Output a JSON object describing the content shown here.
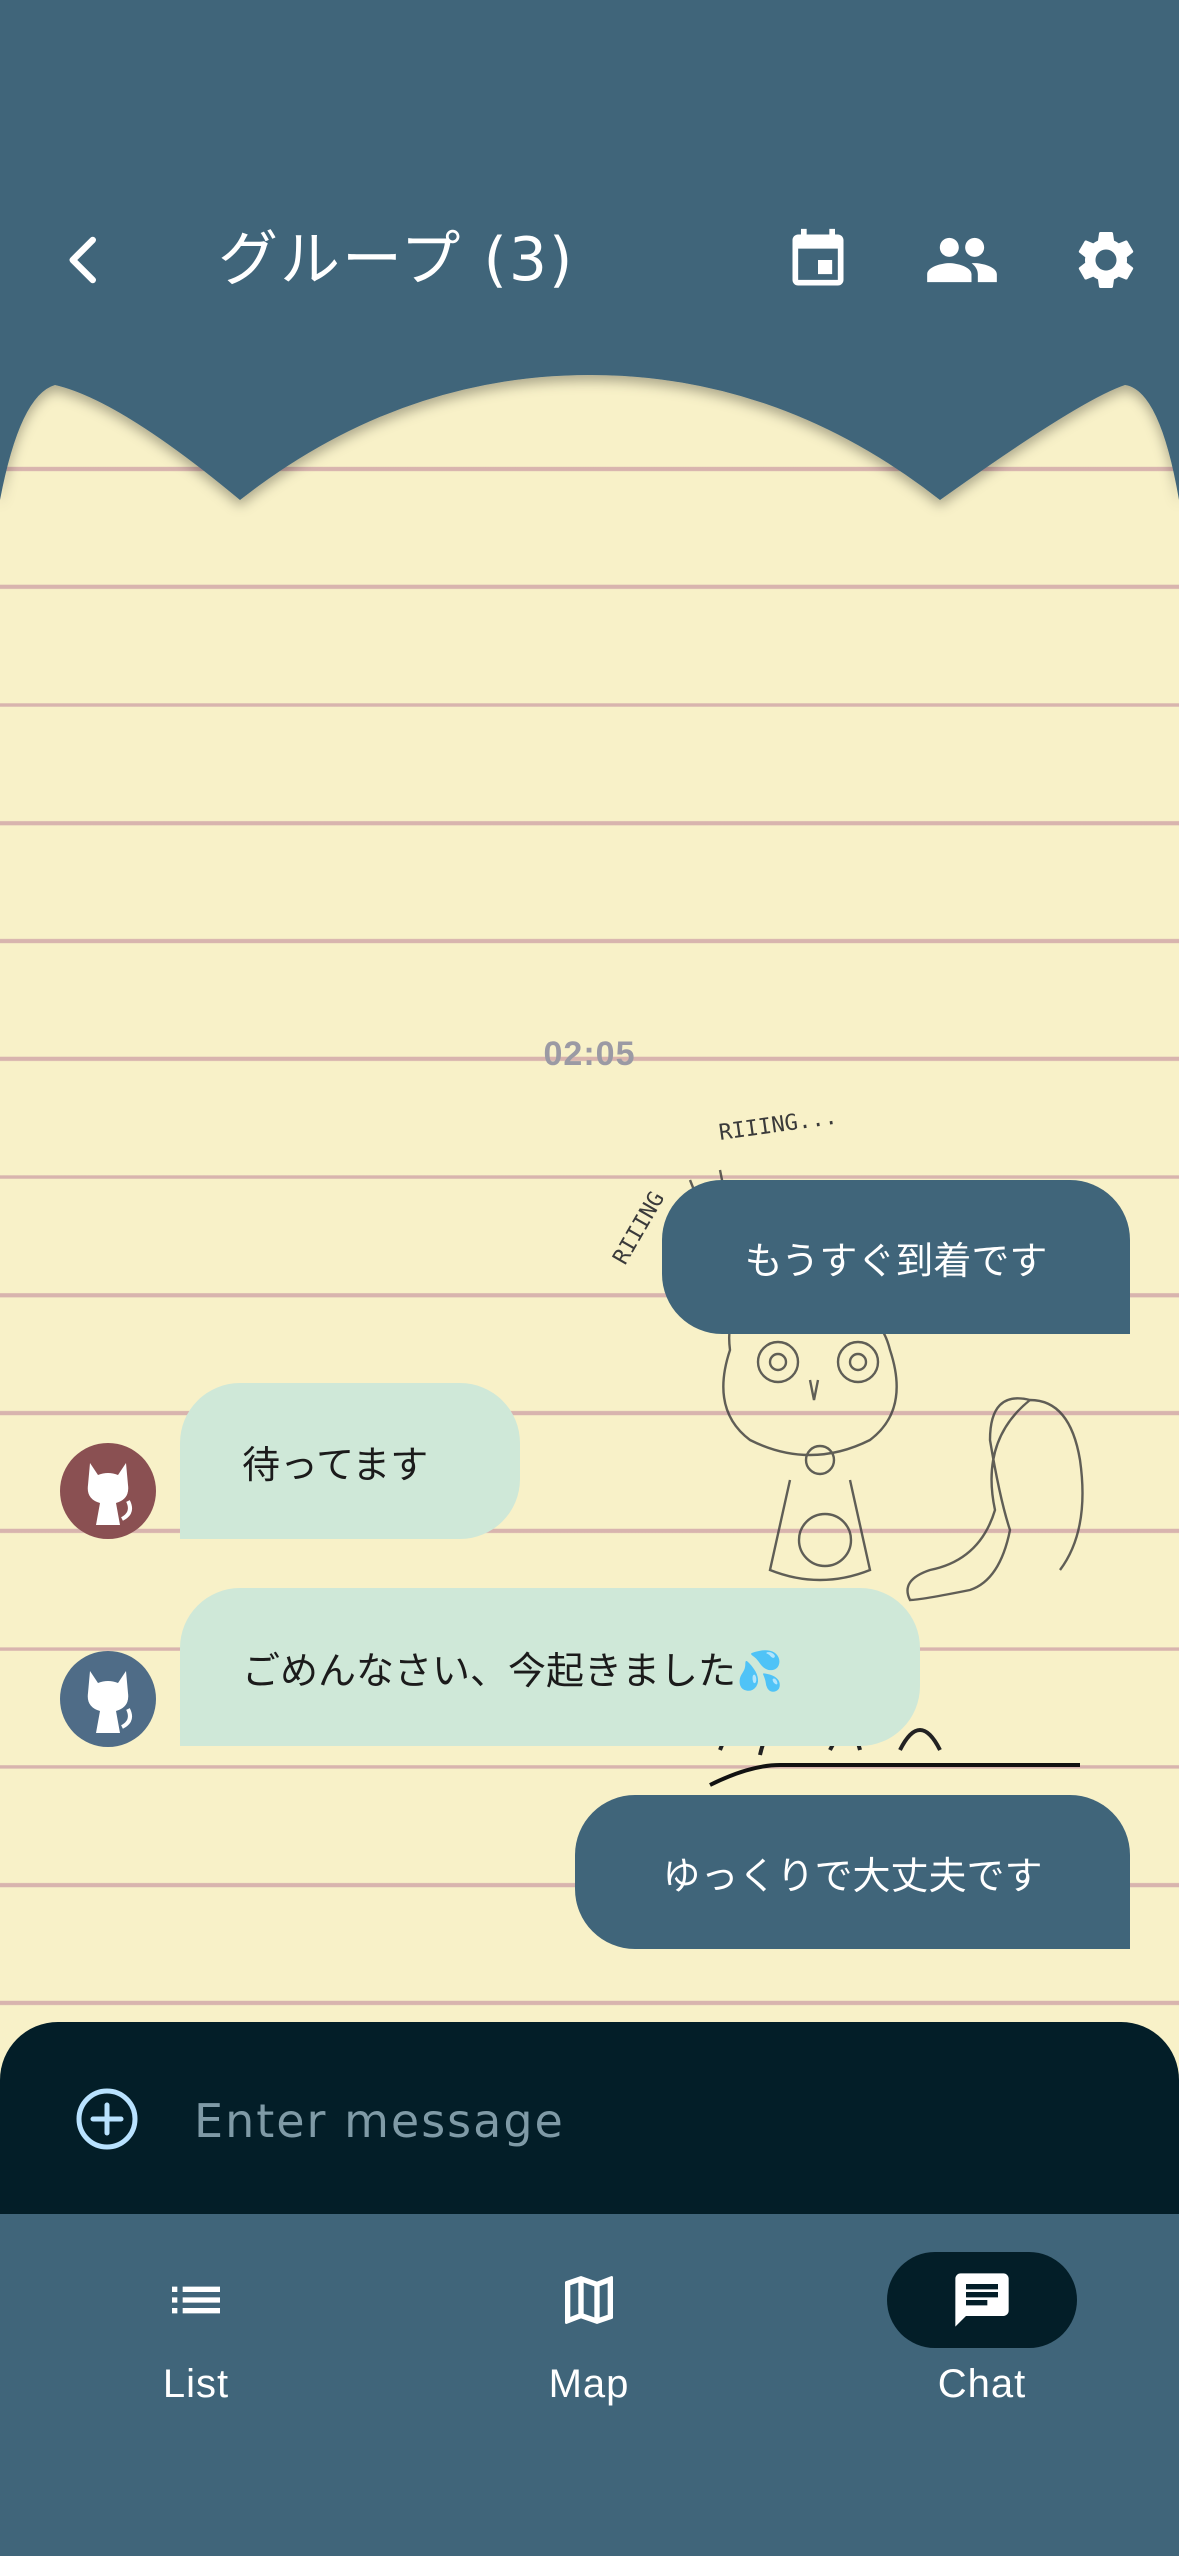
{
  "header": {
    "title": "グループ (3)",
    "icons": [
      "back-arrow-icon",
      "calendar-icon",
      "people-icon",
      "gear-icon"
    ]
  },
  "chat": {
    "timestamp": "02:05",
    "messages": [
      {
        "sender": "me",
        "text": "もうすぐ到着です"
      },
      {
        "sender": "other",
        "avatar_color": "#8a5052",
        "text": "待ってます"
      },
      {
        "sender": "other",
        "avatar_color": "#4f6c87",
        "text": "ごめんなさい、今起きました💦"
      },
      {
        "sender": "me",
        "text": "ゆっくりで大丈夫です"
      }
    ]
  },
  "composer": {
    "placeholder": "Enter message"
  },
  "nav": {
    "items": [
      {
        "label": "List",
        "icon": "list-icon",
        "active": false
      },
      {
        "label": "Map",
        "icon": "map-icon",
        "active": false
      },
      {
        "label": "Chat",
        "icon": "chat-icon",
        "active": true
      }
    ]
  },
  "colors": {
    "primary": "#40657a",
    "dark": "#031e28",
    "paper": "#f8f1c8",
    "bubble_other": "#cfe8d8"
  }
}
